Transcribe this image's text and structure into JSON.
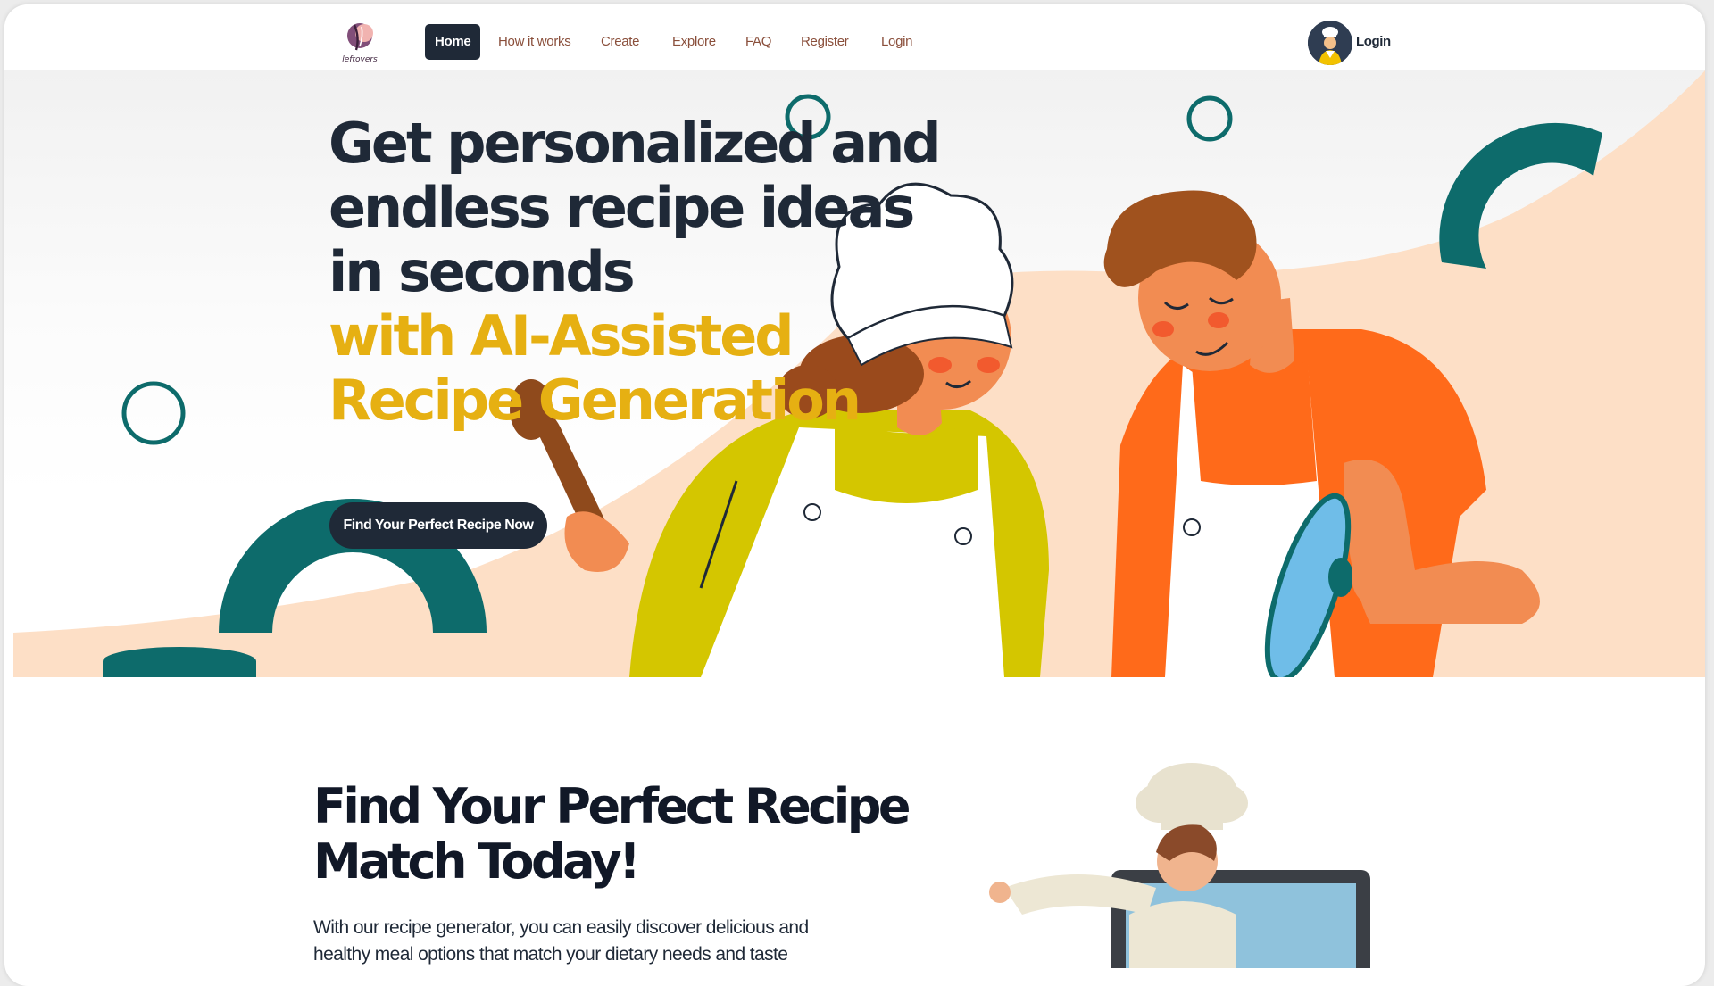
{
  "brand": {
    "logo_text": "leftovers"
  },
  "nav": {
    "items": [
      {
        "label": "Home",
        "active": true
      },
      {
        "label": "How it works"
      },
      {
        "label": "Create"
      },
      {
        "label": "Explore"
      },
      {
        "label": "FAQ"
      },
      {
        "label": "Register"
      },
      {
        "label": "Login"
      }
    ],
    "profile_label": "Login"
  },
  "hero": {
    "title_lines": [
      "Get personalized and",
      "endless recipe ideas",
      "in seconds"
    ],
    "accent_lines": [
      "with AI-Assisted",
      "Recipe Generation"
    ],
    "cta_label": "Find Your Perfect Recipe Now"
  },
  "section2": {
    "title_lines": [
      "Find Your Perfect Recipe",
      "Match Today!"
    ],
    "text": "With our recipe generator, you can easily discover delicious and healthy meal options that match your dietary needs and taste"
  },
  "colors": {
    "dark": "#1f2937",
    "accent": "#e6b012",
    "teal": "#0d6b6b",
    "peach": "#fddfc6",
    "orange": "#ff6a1a",
    "olive": "#d4c600",
    "link": "#8a4f3b"
  }
}
